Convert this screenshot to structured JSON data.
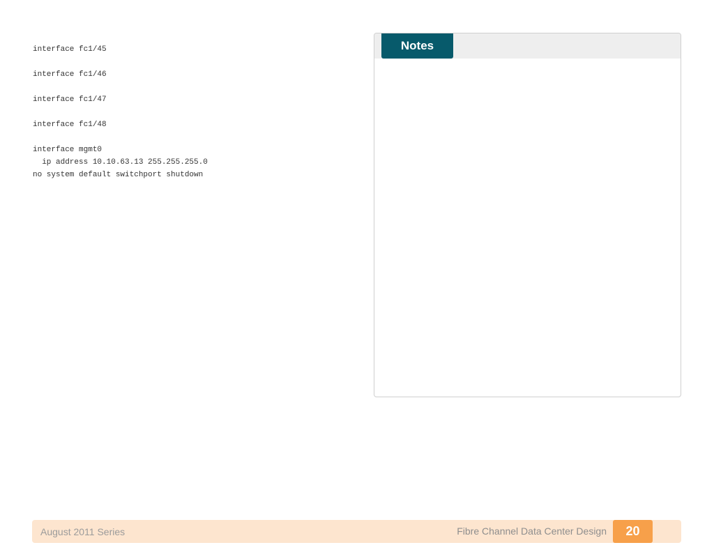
{
  "code_listing": [
    "interface fc1/45",
    "",
    "interface fc1/46",
    "",
    "interface fc1/47",
    "",
    "interface fc1/48",
    "",
    "interface mgmt0",
    "  ip address 10.10.63.13 255.255.255.0",
    "no system default switchport shutdown"
  ],
  "notes": {
    "tab_label": "Notes"
  },
  "footer": {
    "series": "August 2011 Series",
    "doc_title": "Fibre Channel Data Center Design",
    "page_number": "20"
  },
  "colors": {
    "notes_tab": "#075a6b",
    "footer_background": "#fde5cf",
    "page_badge": "#f7a04a"
  }
}
